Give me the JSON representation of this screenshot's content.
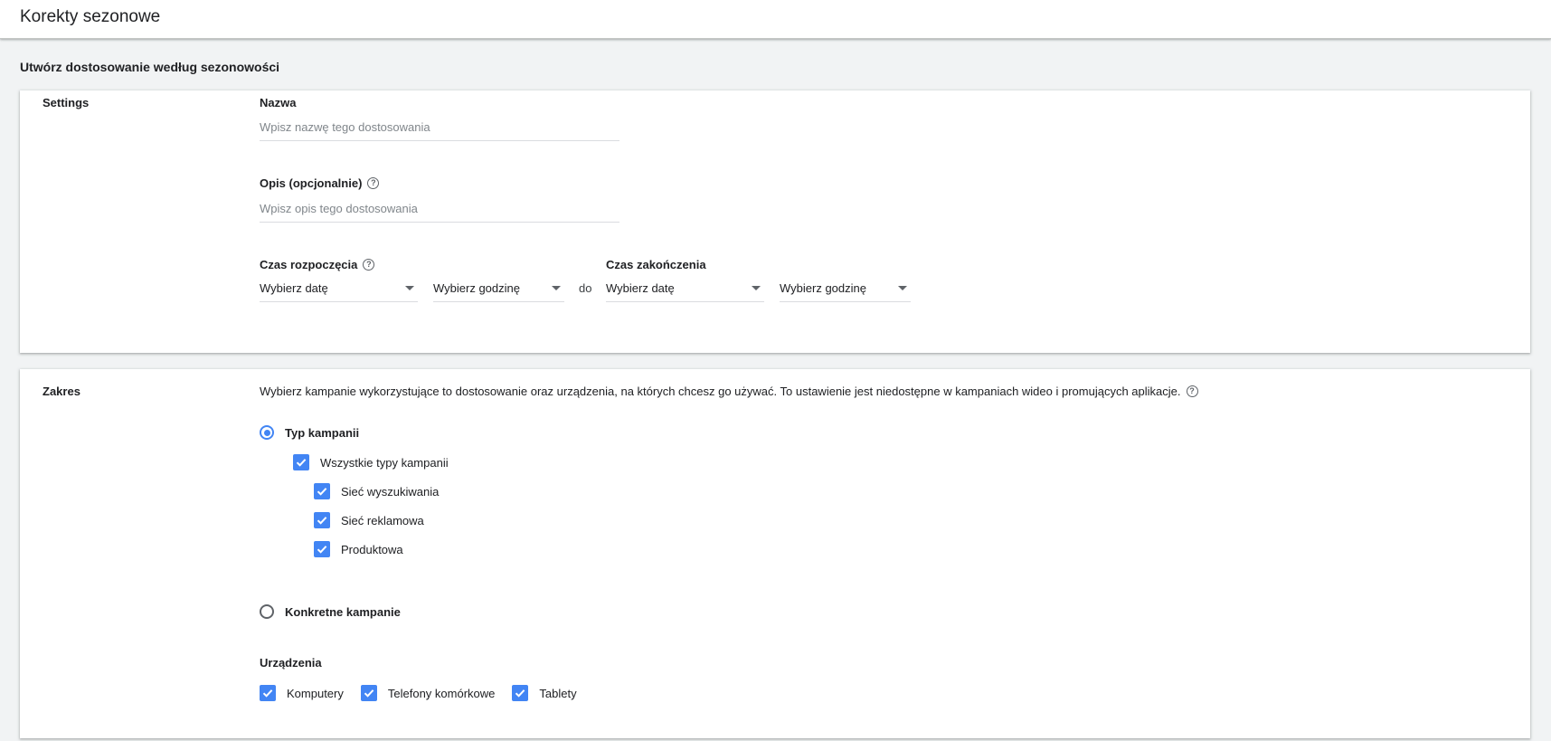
{
  "header": {
    "title": "Korekty sezonowe"
  },
  "page": {
    "heading": "Utwórz dostosowanie według sezonowości"
  },
  "settings": {
    "section_label": "Settings",
    "name": {
      "label": "Nazwa",
      "placeholder": "Wpisz nazwę tego dostosowania",
      "value": ""
    },
    "description": {
      "label": "Opis (opcjonalnie)",
      "placeholder": "Wpisz opis tego dostosowania",
      "value": ""
    },
    "start": {
      "label": "Czas rozpoczęcia",
      "date": "Wybierz datę",
      "time": "Wybierz godzinę"
    },
    "separator": "do",
    "end": {
      "label": "Czas zakończenia",
      "date": "Wybierz datę",
      "time": "Wybierz godzinę"
    }
  },
  "scope": {
    "section_label": "Zakres",
    "description": "Wybierz kampanie wykorzystujące to dostosowanie oraz urządzenia, na których chcesz go używać. To ustawienie jest niedostępne w kampaniach wideo i promujących aplikacje.",
    "campaign_type": {
      "label": "Typ kampanii",
      "selected": true,
      "all_types": {
        "label": "Wszystkie typy kampanii",
        "checked": true
      },
      "types": [
        {
          "label": "Sieć wyszukiwania",
          "checked": true
        },
        {
          "label": "Sieć reklamowa",
          "checked": true
        },
        {
          "label": "Produktowa",
          "checked": true
        }
      ]
    },
    "specific_campaigns": {
      "label": "Konkretne kampanie",
      "selected": false
    },
    "devices": {
      "label": "Urządzenia",
      "items": [
        {
          "label": "Komputery",
          "checked": true
        },
        {
          "label": "Telefony komórkowe",
          "checked": true
        },
        {
          "label": "Tablety",
          "checked": true
        }
      ]
    }
  },
  "colors": {
    "accent": "#4285f4",
    "background": "#f1f3f4",
    "text": "#202124",
    "placeholder": "#80868b"
  },
  "icons": {
    "help": "help-circle-icon",
    "dropdown": "caret-down-icon",
    "check": "check-icon"
  }
}
